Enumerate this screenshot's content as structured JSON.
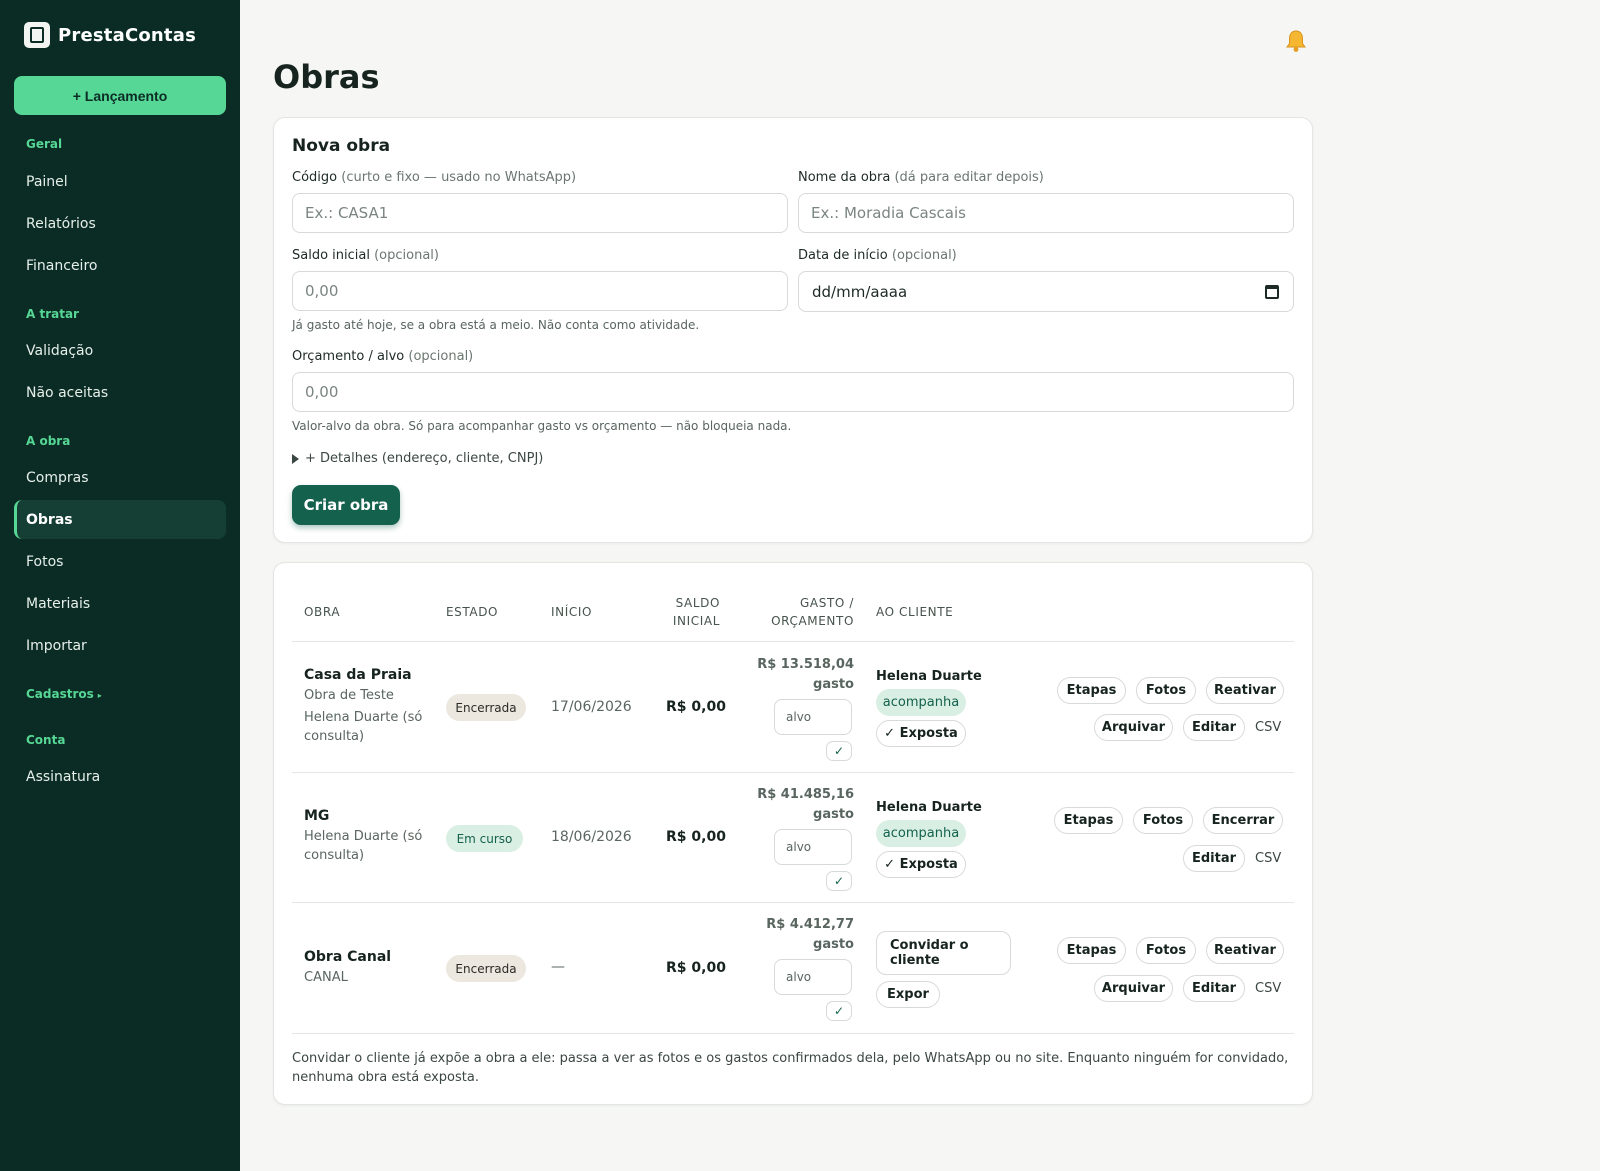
{
  "app": {
    "name": "PrestaContas"
  },
  "sidebar": {
    "launch_label": "+ Lançamento",
    "sections": {
      "geral": "Geral",
      "a_tratar": "A tratar",
      "a_obra": "A obra",
      "cadastros": "Cadastros",
      "conta": "Conta"
    },
    "items": {
      "painel": "Painel",
      "relatorios": "Relatórios",
      "financeiro": "Financeiro",
      "validacao": "Validação",
      "nao_aceitas": "Não aceitas",
      "compras": "Compras",
      "obras": "Obras",
      "fotos": "Fotos",
      "materiais": "Materiais",
      "importar": "Importar",
      "assinatura": "Assinatura"
    },
    "active": "Obras"
  },
  "page": {
    "title": "Obras"
  },
  "form": {
    "title": "Nova obra",
    "codigo": {
      "label": "Código",
      "hint": "(curto e fixo — usado no WhatsApp)",
      "placeholder": "Ex.: CASA1"
    },
    "nome": {
      "label": "Nome da obra",
      "hint": "(dá para editar depois)",
      "placeholder": "Ex.: Moradia Cascais"
    },
    "saldo": {
      "label": "Saldo inicial",
      "hint": "(opcional)",
      "placeholder": "0,00",
      "help": "Já gasto até hoje, se a obra está a meio. Não conta como atividade."
    },
    "data": {
      "label": "Data de início",
      "hint": "(opcional)",
      "value": "dd/mm/aaaa"
    },
    "orcamento": {
      "label": "Orçamento / alvo",
      "hint": "(opcional)",
      "placeholder": "0,00",
      "help": "Valor-alvo da obra. Só para acompanhar gasto vs orçamento — não bloqueia nada."
    },
    "details_label": "+ Detalhes (endereço, cliente, CNPJ)",
    "submit_label": "Criar obra"
  },
  "table": {
    "headers": {
      "obra": "OBRA",
      "estado": "ESTADO",
      "inicio": "INÍCIO",
      "saldo_1": "SALDO",
      "saldo_2": "INICIAL",
      "gasto_1": "GASTO /",
      "gasto_2": "ORÇAMENTO",
      "cliente": "AO CLIENTE"
    },
    "rows": [
      {
        "name": "Casa da Praia",
        "sub1": "Obra de Teste",
        "sub2": "Helena Duarte (só",
        "sub3": "consulta)",
        "estado": "Encerrada",
        "inicio": "17/06/2026",
        "saldo": "R$ 0,00",
        "gasto_value": "R$ 13.518,04",
        "gasto_word": "gasto",
        "alvo_placeholder": "alvo",
        "check": "✓",
        "cliente": "Helena Duarte",
        "cliente_status": "acompanha",
        "exposta_label": "✓ Exposta",
        "actions": {
          "etapas": "Etapas",
          "fotos": "Fotos",
          "toggle": "Reativar",
          "arquivar": "Arquivar",
          "editar": "Editar",
          "csv": "CSV"
        }
      },
      {
        "name": "MG",
        "sub1": "Helena Duarte (só",
        "sub2": "consulta)",
        "estado": "Em curso",
        "inicio": "18/06/2026",
        "saldo": "R$ 0,00",
        "gasto_value": "R$ 41.485,16",
        "gasto_word": "gasto",
        "alvo_placeholder": "alvo",
        "check": "✓",
        "cliente": "Helena Duarte",
        "cliente_status": "acompanha",
        "exposta_label": "✓ Exposta",
        "actions": {
          "etapas": "Etapas",
          "fotos": "Fotos",
          "toggle": "Encerrar",
          "editar": "Editar",
          "csv": "CSV"
        }
      },
      {
        "name": "Obra Canal",
        "sub1": "CANAL",
        "estado": "Encerrada",
        "inicio": "—",
        "saldo": "R$ 0,00",
        "gasto_value": "R$ 4.412,77",
        "gasto_word": "gasto",
        "alvo_placeholder": "alvo",
        "check": "✓",
        "invite_line1": "Convidar o",
        "invite_line2": "cliente",
        "expor_label": "Expor",
        "actions": {
          "etapas": "Etapas",
          "fotos": "Fotos",
          "toggle": "Reativar",
          "arquivar": "Arquivar",
          "editar": "Editar",
          "csv": "CSV"
        }
      }
    ],
    "footnote": "Convidar o cliente já expõe a obra a ele: passa a ver as fotos e os gastos confirmados dela, pelo WhatsApp ou no site. Enquanto ninguém for convidado, nenhuma obra está exposta."
  },
  "colors": {
    "sidebar_bg": "#0b2c25",
    "accent": "#56d795",
    "primary_btn": "#14614d",
    "bell": "#f5b731"
  },
  "icons": {
    "bell": "bell-icon",
    "logo": "logo-icon",
    "calendar": "calendar-icon",
    "details": "disclosure-triangle-icon"
  }
}
